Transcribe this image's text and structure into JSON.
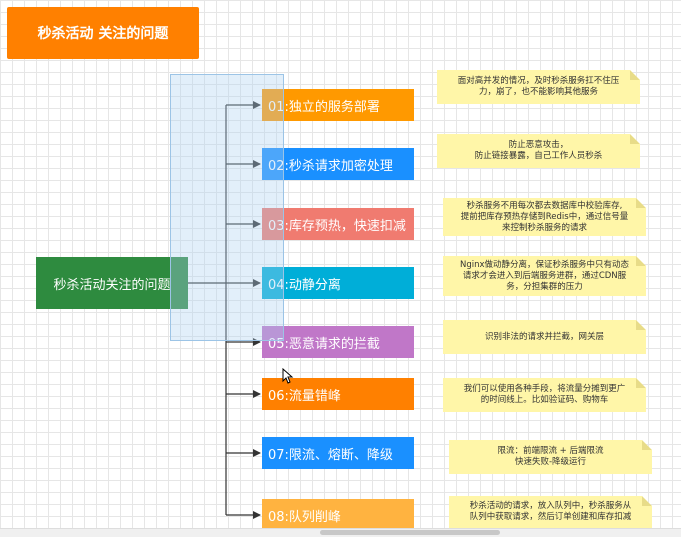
{
  "title": "秒杀活动 关注的问题",
  "center": "秒杀活动关注的问题",
  "branches": [
    {
      "label": "01:独立的服务部署",
      "color": "#ff9900"
    },
    {
      "label": "02:秒杀请求加密处理",
      "color": "#1a90ff"
    },
    {
      "label": "03:库存预热，快速扣减",
      "color": "#f07b70"
    },
    {
      "label": "04:动静分离",
      "color": "#00aed8"
    },
    {
      "label": "05:恶意请求的拦截",
      "color": "#c077c8"
    },
    {
      "label": "06:流量错峰",
      "color": "#ff8000"
    },
    {
      "label": "07:限流、熔断、降级",
      "color": "#1a90ff"
    },
    {
      "label": "08:队列削峰",
      "color": "#ffb340"
    }
  ],
  "notes": [
    {
      "lines": [
        "面对高并发的情况，及时秒杀服务扛不住压",
        "力，崩了，也不能影响其他服务"
      ]
    },
    {
      "lines": [
        "防止恶意攻击，",
        "防止链接暴露，自己工作人员秒杀"
      ]
    },
    {
      "lines": [
        "秒杀服务不用每次都去数据库中校验库存,",
        "提前把库存预热存储到Redis中，通过信号量",
        "来控制秒杀服务的请求"
      ]
    },
    {
      "lines": [
        "Nginx做动静分离，保证秒杀服务中只有动态",
        "请求才会进入到后端服务进群，通过CDN服",
        "务，分担集群的压力"
      ]
    },
    {
      "lines": [
        "识别非法的请求并拦截，网关层"
      ]
    },
    {
      "lines": [
        "我们可以使用各种手段，将流量分摊到更广",
        "的时间线上。比如验证码、购物车"
      ]
    },
    {
      "lines": [
        "限流：前端限流 + 后端限流",
        "快速失败-降级运行"
      ]
    },
    {
      "lines": [
        "秒杀活动的请求，放入队列中，秒杀服务从",
        "队列中获取请求，然后订单创建和库存扣减"
      ]
    }
  ]
}
